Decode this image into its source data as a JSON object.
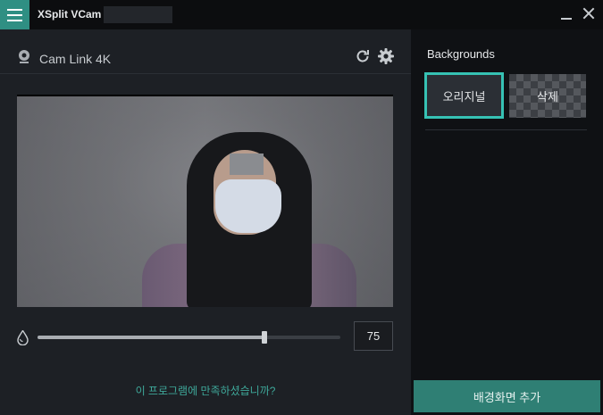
{
  "app": {
    "title": "XSplit VCam -"
  },
  "camera": {
    "name": "Cam Link 4K",
    "icon": "webcam-icon"
  },
  "slider": {
    "value": 75,
    "value_text": "75",
    "min": 0,
    "max": 100,
    "icon": "droplet-icon"
  },
  "feedback": {
    "text": "이 프로그램에 만족하셨습니까?"
  },
  "backgrounds": {
    "title": "Backgrounds",
    "items": [
      {
        "label": "오리지널",
        "selected": true
      },
      {
        "label": "삭제",
        "selected": false
      }
    ],
    "add_button": "배경화면 추가"
  },
  "colors": {
    "accent": "#36c2b4",
    "menu_button": "#2f8f83",
    "add_button": "#2f7f74",
    "link": "#3ea89a"
  }
}
